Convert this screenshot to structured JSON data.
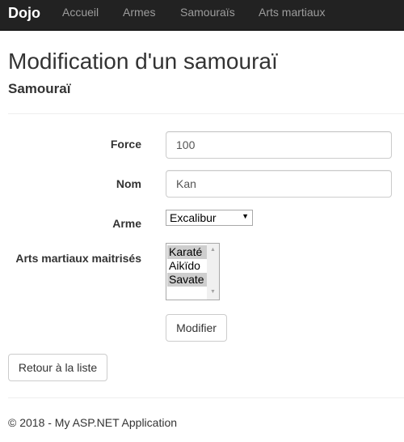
{
  "navbar": {
    "brand": "Dojo",
    "links": [
      "Accueil",
      "Armes",
      "Samouraïs",
      "Arts martiaux"
    ]
  },
  "page": {
    "title": "Modification d'un samouraï",
    "subtitle": "Samouraï"
  },
  "form": {
    "force": {
      "label": "Force",
      "value": "100"
    },
    "nom": {
      "label": "Nom",
      "value": "Kan"
    },
    "arme": {
      "label": "Arme",
      "selected": "Excalibur"
    },
    "arts": {
      "label": "Arts martiaux maitrisés",
      "options": [
        {
          "text": "Karaté",
          "selected": true
        },
        {
          "text": "Aikïdo",
          "selected": false
        },
        {
          "text": "Savate",
          "selected": true
        }
      ]
    },
    "submit_label": "Modifier"
  },
  "back_label": "Retour à la liste",
  "footer": "© 2018 - My ASP.NET Application",
  "colors": {
    "navbar_bg": "#222222",
    "nav_link": "#9d9d9d",
    "brand": "#ffffff",
    "selected_option_bg": "#cecece"
  }
}
